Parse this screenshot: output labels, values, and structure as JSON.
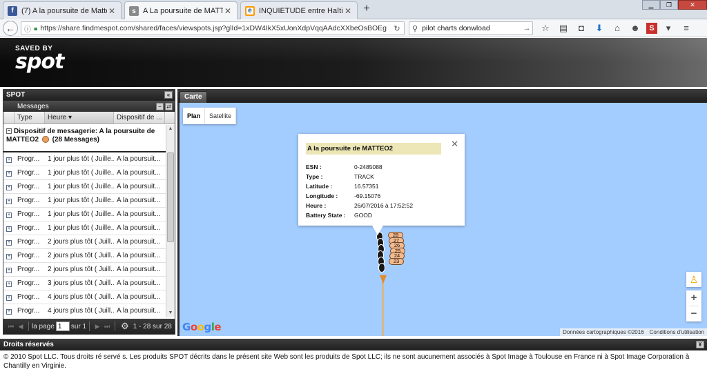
{
  "browser": {
    "tabs": [
      {
        "title": "(7) A la poursuite de Matté...",
        "favicon": "f",
        "favicon_color": "#3b5998"
      },
      {
        "title": "A La poursuite de MATTEO2",
        "favicon": "s",
        "favicon_color": "#8a8a8a"
      },
      {
        "title": "INQUIETUDE entre Haïti et...",
        "favicon": "e",
        "favicon_color": "#ff9900"
      }
    ],
    "url": "https://share.findmespot.com/shared/faces/viewspots.jsp?glId=1xDW4IkX5xUonXdpVqqAAdcXXbeOsBOEg",
    "search_value": "pilot charts donwload"
  },
  "header": {
    "logo_top": "SAVED BY",
    "logo_main": "spot"
  },
  "left_panel": {
    "title": "SPOT",
    "subtitle": "Messages",
    "columns": [
      "Type",
      "Heure",
      "Dispositif de ..."
    ],
    "group_label_a": "Dispositif de messagerie: A la poursuite de MATTEO2",
    "group_label_b": "(28 Messages)",
    "rows": [
      {
        "type": "Progr...",
        "heure": "1 jour plus tôt ( Juille...",
        "dispositif": "A la poursuit..."
      },
      {
        "type": "Progr...",
        "heure": "1 jour plus tôt ( Juille...",
        "dispositif": "A la poursuit..."
      },
      {
        "type": "Progr...",
        "heure": "1 jour plus tôt ( Juille...",
        "dispositif": "A la poursuit..."
      },
      {
        "type": "Progr...",
        "heure": "1 jour plus tôt ( Juille...",
        "dispositif": "A la poursuit..."
      },
      {
        "type": "Progr...",
        "heure": "1 jour plus tôt ( Juille...",
        "dispositif": "A la poursuit..."
      },
      {
        "type": "Progr...",
        "heure": "1 jour plus tôt ( Juille...",
        "dispositif": "A la poursuit..."
      },
      {
        "type": "Progr...",
        "heure": "2 jours plus tôt ( Juill...",
        "dispositif": "A la poursuit..."
      },
      {
        "type": "Progr...",
        "heure": "2 jours plus tôt ( Juill...",
        "dispositif": "A la poursuit..."
      },
      {
        "type": "Progr...",
        "heure": "2 jours plus tôt ( Juill...",
        "dispositif": "A la poursuit..."
      },
      {
        "type": "Progr...",
        "heure": "3 jours plus tôt ( Juill...",
        "dispositif": "A la poursuit..."
      },
      {
        "type": "Progr...",
        "heure": "4 jours plus tôt ( Juill...",
        "dispositif": "A la poursuit..."
      },
      {
        "type": "Progr...",
        "heure": "4 jours plus tôt ( Juill...",
        "dispositif": "A la poursuit..."
      }
    ],
    "pager": {
      "page_label": "la page",
      "page_value": "1",
      "of_label": "sur 1",
      "range": "1 - 28 sur 28"
    }
  },
  "map_panel": {
    "tab": "Carte",
    "map_types": [
      "Plan",
      "Satellite"
    ],
    "popup": {
      "title": "A la poursuite de MATTEO2",
      "fields": [
        {
          "k": "ESN :",
          "v": "0-2485088"
        },
        {
          "k": "Type :",
          "v": "TRACK"
        },
        {
          "k": "Latitude :",
          "v": "16.57351"
        },
        {
          "k": "Longitude :",
          "v": "-69.15076"
        },
        {
          "k": "Heure :",
          "v": "26/07/2016 à 17:52:52"
        },
        {
          "k": "Battery State :",
          "v": "GOOD"
        }
      ]
    },
    "markers": [
      "28",
      "27",
      "26",
      "25",
      "24",
      "23"
    ],
    "attribution": "Données cartographiques ©2016",
    "terms": "Conditions d'utilisation"
  },
  "footer": {
    "title": "Droits réservés",
    "text": "© 2010 Spot LLC. Tous droits ré servé s. Les produits SPOT décrits dans le présent site Web sont les produits de Spot LLC; ils ne sont aucunement associés à Spot Image à Toulouse en France ni à Spot Image Corporation à Chantilly en Virginie."
  }
}
